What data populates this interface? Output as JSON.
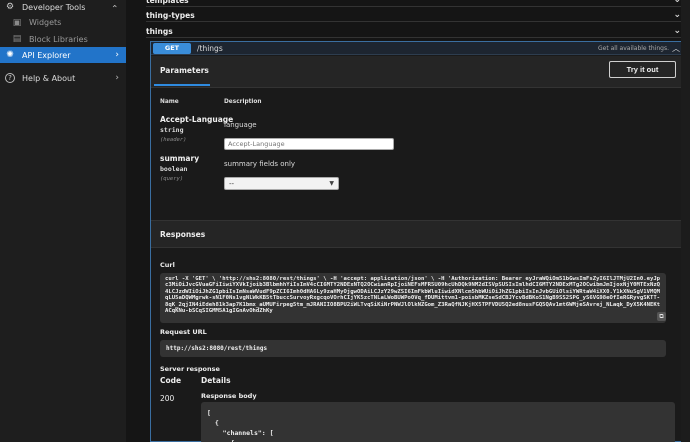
{
  "sidebar": {
    "items": [
      {
        "label": "Developer Tools",
        "icon": "gear-icon",
        "glyph": "⚙",
        "chevron": "⌄"
      },
      {
        "label": "Widgets",
        "icon": "widget-icon",
        "glyph": "▣"
      },
      {
        "label": "Block Libraries",
        "icon": "block-icon",
        "glyph": "▤"
      },
      {
        "label": "API Explorer",
        "icon": "api-icon",
        "glyph": "✺",
        "chevron": "›"
      },
      {
        "label": "Help & About",
        "icon": "help-icon",
        "glyph": "?",
        "chevron": "›"
      }
    ],
    "accent": "#2274c9"
  },
  "main": {
    "sections": [
      "templates",
      "thing-types",
      "things"
    ],
    "chevron_down": "⌄",
    "operation": {
      "method": "GET",
      "path": "/things",
      "summary": "Get all available things.",
      "collapse": "︿",
      "tab": "Parameters",
      "try_button": "Try it out",
      "col_name": "Name",
      "col_desc": "Description",
      "params": [
        {
          "name": "Accept-Language",
          "type": "string",
          "in": "(header)",
          "desc": "language",
          "placeholder": "Accept-Language"
        },
        {
          "name": "summary",
          "type": "boolean",
          "in": "(query)",
          "desc": "summary fields only",
          "selected": "--"
        }
      ],
      "responses_title": "Responses",
      "curl_label": "Curl",
      "curl": "curl -X 'GET' \\ 'http://shs2:8080/rest/things' \\ -H 'accept: application/json' \\ -H 'Authorization: Bearer eyJraWQiOm51bGwsImFsZyI6IlJTMjU2In0.eyJpc3MiOiJvcGVuaGFiIiwiYXVkIjoib3BlbmhhYiIsImV4cCI6MTY2NDExNTQ2OCwianRpIjoiNEFsMFR5U09hcUhDQk9NM2dISVpSUSIsImlhdCI6MTY2NDExMTg2OCwibmJmIjoxNjY0MTExNzQ4LCJzdWIiOiJhZG1pbiIsImNsaWVudF9pZCI6Imh0dHA6Ly9zaHMyOjgwODAiLCJzY29wZSI6ImFkbWluIiwidXNlcm5hbWUiOiJhZG1pbiIsInJvbGUiOlsiYWRtaW4iXX0.Y1kXNuSgV1VMQMqLU5aDQWMgrwk-sN1F0Ns1vgNLWkKB5tTbuccSurvoyRxgcqoVOrhCIjYK5zcTNLaLWoBUWPo0Vq_fDUMittvm1-poisbMKZseSdCBJYcvBdBKoS1NgB9SS2SPG_yS6VG98eOfIeRGRyvgSKTT-8qK_2qjIN4iEdeh81k3ap7K1bmx_aUMUFirpeg5tm_mJRANIIO8BPU2iWLTvqSiKiNrPNWJlOlkNZGom_Z3RaQfNJKjHX5TPFVDU5Q2ed8nusFGQ5QAv1mt6WMjeSAvrej_NLaqk_DyX5K4NEKtACqKNu-bSCqSIGMM5A1gIGnAvOhdZhKy",
      "copy_icon": "⧉",
      "request_url_label": "Request URL",
      "request_url": "http://shs2:8080/rest/things",
      "server_response_label": "Server response",
      "code_header": "Code",
      "details_header": "Details",
      "code": "200",
      "response_body_label": "Response body",
      "response_body": "[\n  {\n    \"channels\": [\n      {"
    }
  }
}
